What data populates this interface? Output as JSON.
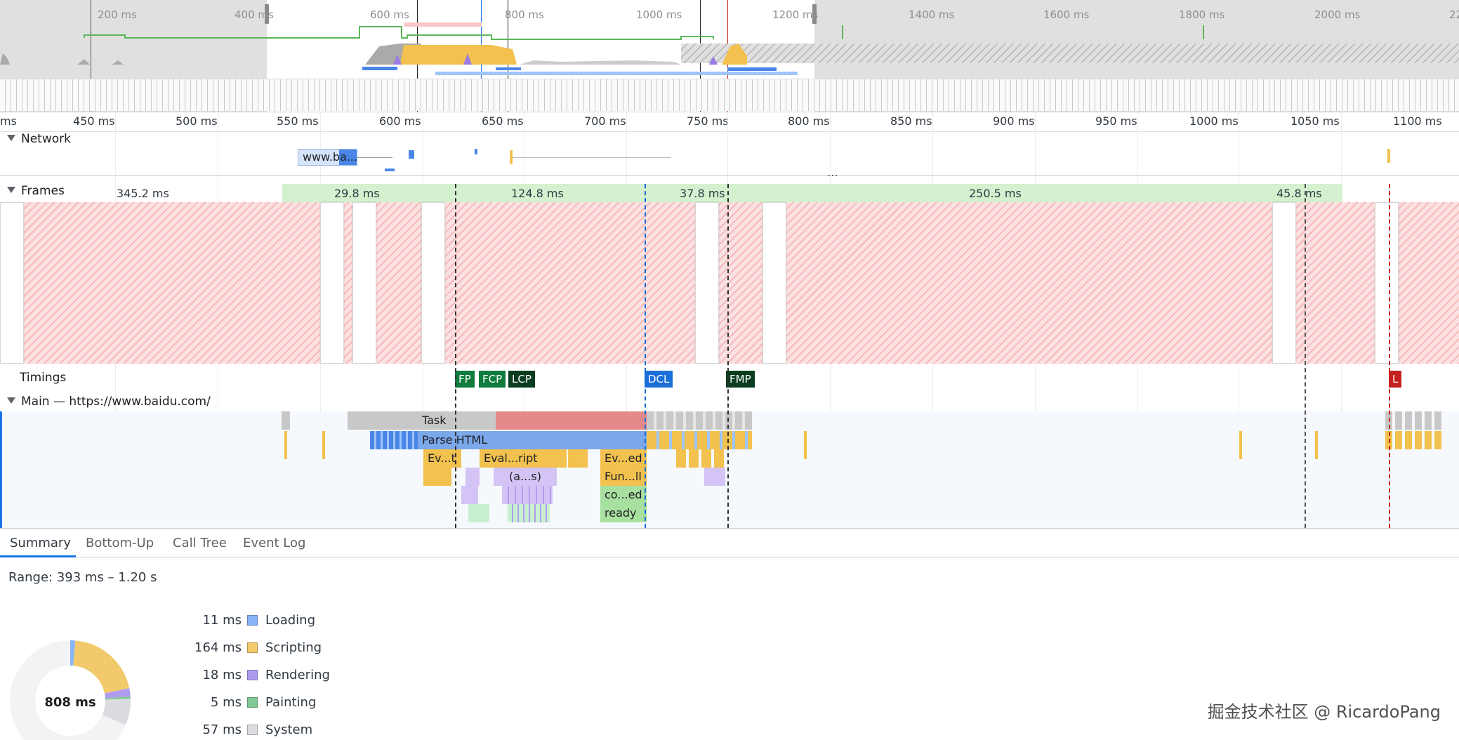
{
  "overview": {
    "ticks": [
      "200 ms",
      "400 ms",
      "600 ms",
      "800 ms",
      "1000 ms",
      "1200 ms",
      "1400 ms",
      "1600 ms",
      "1800 ms",
      "2000 ms",
      "22"
    ]
  },
  "ruler": {
    "ticks": [
      "ms",
      "450 ms",
      "500 ms",
      "550 ms",
      "600 ms",
      "650 ms",
      "700 ms",
      "750 ms",
      "800 ms",
      "850 ms",
      "900 ms",
      "950 ms",
      "1000 ms",
      "1050 ms",
      "1100 ms"
    ]
  },
  "network": {
    "label": "Network",
    "request_label": "www.ba..."
  },
  "frames": {
    "label": "Frames",
    "durations": [
      "345.2 ms",
      "29.8 ms",
      "124.8 ms",
      "37.8 ms",
      "250.5 ms",
      "45.8 ms"
    ]
  },
  "timings": {
    "label": "Timings",
    "markers": [
      "FP",
      "FCP",
      "LCP",
      "DCL",
      "FMP",
      "L"
    ],
    "colors": {
      "fp": "#0f7b3d",
      "fcp": "#0f7b3d",
      "lcp": "#0a3d1f",
      "dcl": "#1a6fd8",
      "fmp": "#0a3d1f",
      "l": "#c5221f"
    }
  },
  "main": {
    "label": "Main — https://www.baidu.com/",
    "flame": {
      "task": "Task",
      "parse_html": "Parse HTML",
      "ev_t": "Ev...t",
      "eval_script": "Eval...ript",
      "ev_ed": "Ev...ed",
      "as": "(a...s)",
      "fun_ll": "Fun...ll",
      "co_ed": "co...ed",
      "ready": "ready"
    }
  },
  "tabs": [
    "Summary",
    "Bottom-Up",
    "Call Tree",
    "Event Log"
  ],
  "summary": {
    "range": "Range: 393 ms – 1.20 s",
    "total": "808 ms",
    "legend": [
      {
        "value": "11 ms",
        "name": "Loading",
        "color": "#8ab4f8"
      },
      {
        "value": "164 ms",
        "name": "Scripting",
        "color": "#f2ca6b"
      },
      {
        "value": "18 ms",
        "name": "Rendering",
        "color": "#af9bf0"
      },
      {
        "value": "5 ms",
        "name": "Painting",
        "color": "#81c995"
      },
      {
        "value": "57 ms",
        "name": "System",
        "color": "#dadce0"
      }
    ]
  },
  "watermark": "掘金技术社区 @ RicardoPang"
}
